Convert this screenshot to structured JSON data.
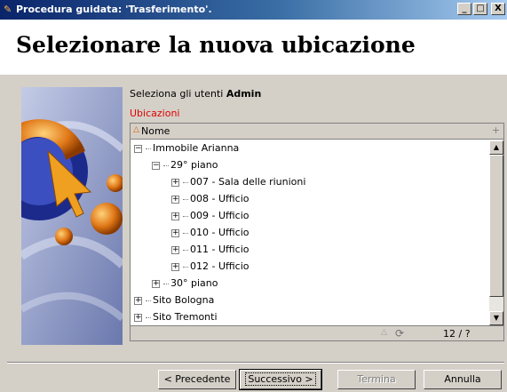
{
  "window": {
    "title": "Procedura guidata: 'Trasferimento'.",
    "app_icon": "wizard-icon",
    "controls": {
      "minimize": "_",
      "maximize": "□",
      "close": "X"
    }
  },
  "header": {
    "title": "Selezionare la nuova ubicazione"
  },
  "graphic": {
    "icon": "wizard-graphic"
  },
  "instruction": {
    "prefix": "Seleziona gli utenti",
    "bold": "Admin"
  },
  "group_label": "Ubicazioni",
  "tree": {
    "column_header": "Nome",
    "sort_icon": "sort-ascending-icon",
    "rows": [
      {
        "label": "Immobile Arianna",
        "expander": "−",
        "level": 0
      },
      {
        "label": "29° piano",
        "expander": "−",
        "level": 1
      },
      {
        "label": "007 - Sala delle riunioni",
        "expander": "+",
        "level": 2
      },
      {
        "label": "008 - Ufficio",
        "expander": "+",
        "level": 2
      },
      {
        "label": "009 - Ufficio",
        "expander": "+",
        "level": 2
      },
      {
        "label": "010 - Ufficio",
        "expander": "+",
        "level": 2
      },
      {
        "label": "011 - Ufficio",
        "expander": "+",
        "level": 2
      },
      {
        "label": "012 - Ufficio",
        "expander": "+",
        "level": 2
      },
      {
        "label": "30° piano",
        "expander": "+",
        "level": 1
      },
      {
        "label": "Sito Bologna",
        "expander": "+",
        "level": 0
      },
      {
        "label": "Sito Tremonti",
        "expander": "+",
        "level": 0
      }
    ],
    "count": "12 / ?"
  },
  "buttons": {
    "previous": "< Precedente",
    "next": "Successivo >",
    "finish": "Termina",
    "cancel": "Annulla"
  }
}
